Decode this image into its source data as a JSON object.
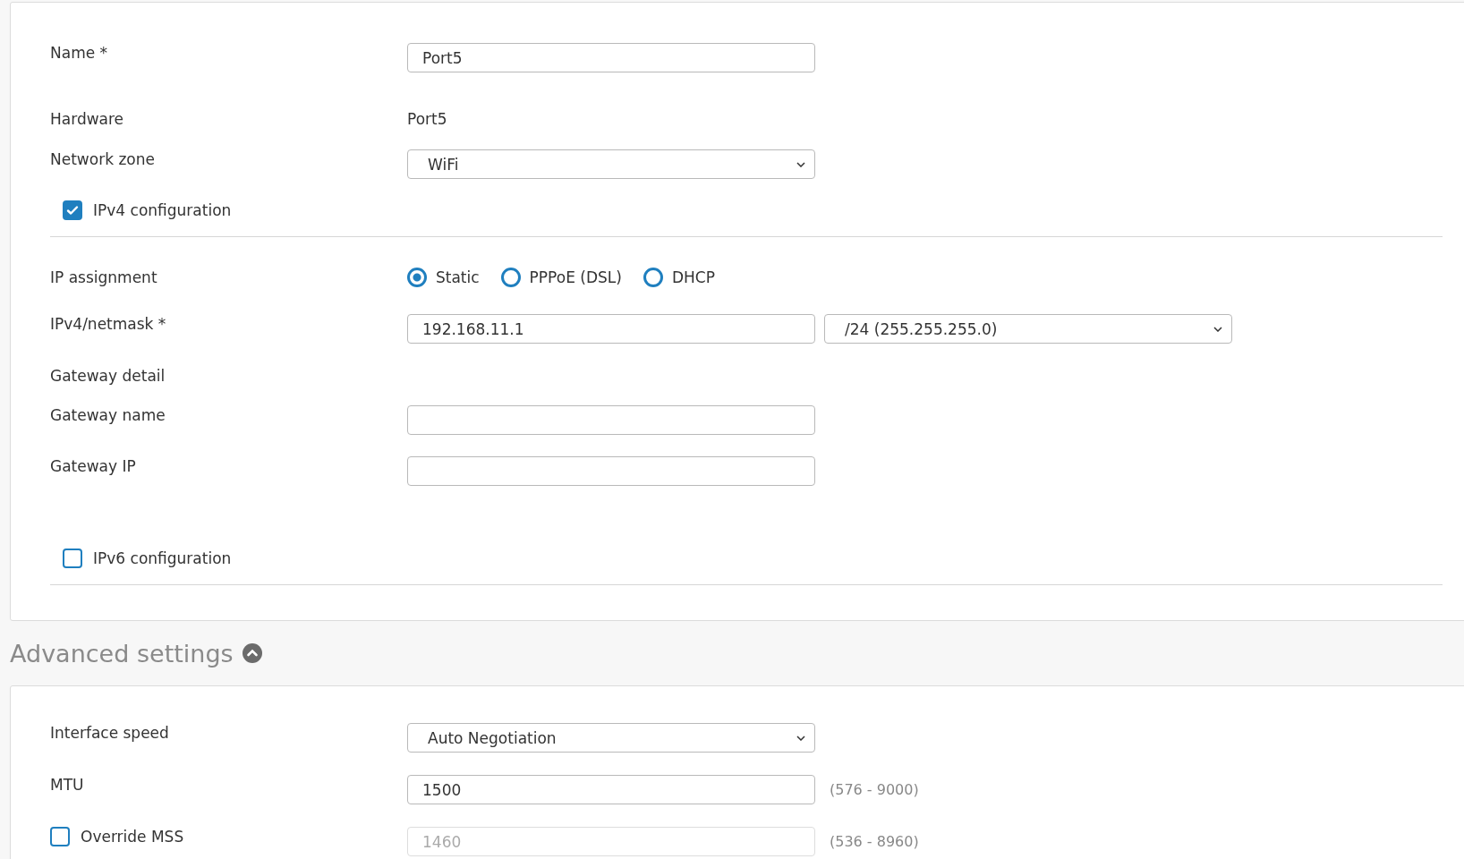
{
  "main_section": {
    "rows": [
      {
        "kind": "input",
        "label": "Name *",
        "value": "Port5"
      },
      {
        "kind": "text",
        "label": "Hardware",
        "value": "Port5"
      },
      {
        "kind": "select",
        "label": "Network zone",
        "value": "WiFi"
      },
      {
        "kind": "checkbox",
        "label": "IPv4 configuration",
        "checked": true
      },
      {
        "kind": "radio",
        "label": "IP assignment",
        "options": [
          {
            "label": "Static",
            "selected": true
          },
          {
            "label": "PPPoE (DSL)",
            "selected": false
          },
          {
            "label": "DHCP",
            "selected": false
          }
        ]
      },
      {
        "kind": "input_select",
        "label": "IPv4/netmask *",
        "value": "192.168.11.1",
        "select": "/24 (255.255.255.0)"
      },
      {
        "kind": "heading",
        "label": "Gateway detail"
      },
      {
        "kind": "input",
        "label": "Gateway name"
      },
      {
        "kind": "input",
        "label": "Gateway IP"
      },
      {
        "kind": "checkbox",
        "label": "IPv6 configuration",
        "checked": false
      }
    ]
  },
  "advanced": {
    "title": "Advanced settings",
    "expanded": true,
    "rows": [
      {
        "kind": "select",
        "label": "Interface speed",
        "value": "Auto Negotiation"
      },
      {
        "kind": "input",
        "label": "MTU",
        "value": "1500",
        "hint": "(576 - 9000)",
        "disabled": false
      },
      {
        "kind": "check_input",
        "label": "Override MSS",
        "checked": false,
        "placeholder": "1460",
        "hint": "(536 - 8960)",
        "disabled": true
      }
    ]
  }
}
